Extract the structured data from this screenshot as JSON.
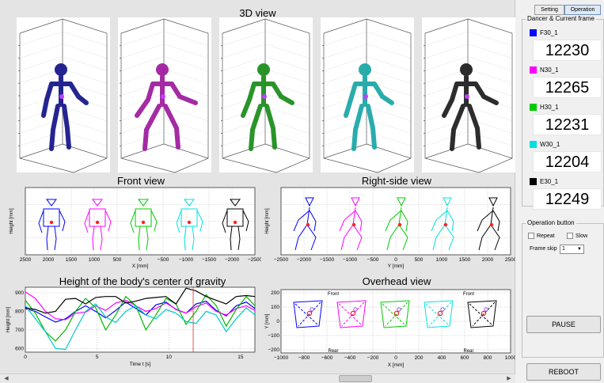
{
  "main": {
    "titles": {
      "view3d": "3D view",
      "front": "Front view",
      "side": "Right-side view",
      "cog": "Height of the body's center of gravity",
      "overhead": "Overhead view"
    },
    "front_chart": {
      "ylabel": "Height [mm]",
      "xlabel": "X [mm]",
      "xticks": [
        "2500",
        "2000",
        "1500",
        "1000",
        "500",
        "0",
        "−500",
        "−1000",
        "−1500",
        "−2000",
        "−2500"
      ]
    },
    "side_chart": {
      "ylabel": "Height [mm]",
      "xlabel": "Y [mm]",
      "xticks": [
        "−2500",
        "−2000",
        "−1500",
        "−1000",
        "−500",
        "0",
        "500",
        "1000",
        "1500",
        "2000",
        "2500"
      ]
    },
    "overhead_chart": {
      "ylabel": "Y [mm]",
      "xlabel": "X [mm]",
      "xticks": [
        "−1000",
        "−800",
        "−600",
        "−400",
        "−200",
        "0",
        "200",
        "400",
        "600",
        "800",
        "1000"
      ],
      "yticks": [
        "200",
        "100",
        "0",
        "−100",
        "−200"
      ],
      "labels": {
        "front1": "Front",
        "rear1": "Rear",
        "front2": "Front",
        "rear2": "Rear"
      }
    }
  },
  "chart_data": {
    "type": "line",
    "title": "Height of the body's center of gravity",
    "xlabel": "Time t [s]",
    "ylabel": "Height [mm]",
    "xlim": [
      0,
      16
    ],
    "ylim": [
      580,
      930
    ],
    "xticks": [
      "0",
      "5",
      "10",
      "15"
    ],
    "yticks": [
      "900",
      "800",
      "700",
      "600"
    ],
    "grid": true,
    "cursor_x": 11.7,
    "series": [
      {
        "color": "#0000ff",
        "x": [
          0,
          0.7,
          1.4,
          2.1,
          2.8,
          3.5,
          4.2,
          4.9,
          5.6,
          6.3,
          7,
          7.7,
          8.4,
          9.1,
          9.8,
          10.5,
          11.2,
          11.9,
          12.6,
          13.3,
          14,
          14.7,
          15.4,
          16
        ],
        "y": [
          815,
          800,
          770,
          742,
          760,
          800,
          830,
          800,
          765,
          805,
          850,
          815,
          780,
          835,
          850,
          810,
          790,
          840,
          855,
          805,
          775,
          830,
          850,
          815
        ]
      },
      {
        "color": "#ff00ff",
        "x": [
          0,
          0.7,
          1.4,
          2.1,
          2.8,
          3.5,
          4.2,
          4.9,
          5.6,
          6.3,
          7,
          7.7,
          8.4,
          9.1,
          9.8,
          10.5,
          11.2,
          11.9,
          12.6,
          13.3,
          14,
          14.7,
          15.4,
          16
        ],
        "y": [
          905,
          870,
          800,
          760,
          755,
          790,
          795,
          830,
          805,
          845,
          860,
          830,
          800,
          815,
          845,
          812,
          790,
          825,
          845,
          800,
          780,
          815,
          830,
          805
        ]
      },
      {
        "color": "#00bb00",
        "x": [
          0,
          0.7,
          1.4,
          2.1,
          2.8,
          3.5,
          4.2,
          4.9,
          5.6,
          6.3,
          7,
          7.7,
          8.4,
          9.1,
          9.8,
          10.5,
          11.2,
          11.9,
          12.6,
          13.3,
          14,
          14.7,
          15.4,
          16
        ],
        "y": [
          860,
          790,
          690,
          640,
          700,
          800,
          870,
          820,
          700,
          780,
          880,
          830,
          700,
          780,
          870,
          840,
          730,
          800,
          890,
          830,
          720,
          810,
          880,
          830
        ]
      },
      {
        "color": "#00c8c8",
        "x": [
          0,
          0.7,
          1.4,
          2.1,
          2.8,
          3.5,
          4.2,
          4.9,
          5.6,
          6.3,
          7,
          7.7,
          8.4,
          9.1,
          9.8,
          10.5,
          11.2,
          11.9,
          12.6,
          13.3,
          14,
          14.7,
          15.4,
          16
        ],
        "y": [
          830,
          760,
          690,
          600,
          595,
          700,
          800,
          840,
          770,
          740,
          800,
          830,
          780,
          760,
          810,
          790,
          745,
          735,
          800,
          780,
          690,
          760,
          820,
          780
        ]
      },
      {
        "color": "#000000",
        "x": [
          0,
          0.7,
          1.4,
          2.1,
          2.8,
          3.5,
          4.2,
          4.9,
          5.6,
          6.3,
          7,
          7.7,
          8.4,
          9.1,
          9.8,
          10.5,
          11.2,
          11.9,
          12.6,
          13.3,
          14,
          14.7,
          15.4,
          16
        ],
        "y": [
          820,
          810,
          790,
          800,
          865,
          870,
          840,
          875,
          880,
          880,
          845,
          855,
          870,
          875,
          880,
          840,
          925,
          910,
          880,
          860,
          840,
          880,
          885,
          880
        ]
      }
    ]
  },
  "sidebar": {
    "tabs": [
      {
        "label": "Setting",
        "active": false
      },
      {
        "label": "Operation",
        "active": true
      }
    ],
    "dancer_group_title": "Dancer & Current frame",
    "dancers": [
      {
        "name": "F30_1",
        "frame": "12230",
        "color": "#0000ff"
      },
      {
        "name": "N30_1",
        "frame": "12265",
        "color": "#ff00ff"
      },
      {
        "name": "H30_1",
        "frame": "12231",
        "color": "#00cc00"
      },
      {
        "name": "W30_1",
        "frame": "12204",
        "color": "#00e0e0"
      },
      {
        "name": "E30_1",
        "frame": "12249",
        "color": "#000000"
      }
    ],
    "operation_group_title": "Operation button",
    "repeat_label": "Repeat",
    "slow_label": "Slow",
    "frame_skip_label": "Frame skip",
    "frame_skip_value": "1",
    "pause_label": "PAUSE",
    "reboot_label": "REBOOT"
  },
  "figure_colors": {
    "blue": "#1a1a8c",
    "magenta": "#a020a0",
    "green": "#1f8f1f",
    "cyan": "#1fa8a8",
    "black": "#222222"
  }
}
